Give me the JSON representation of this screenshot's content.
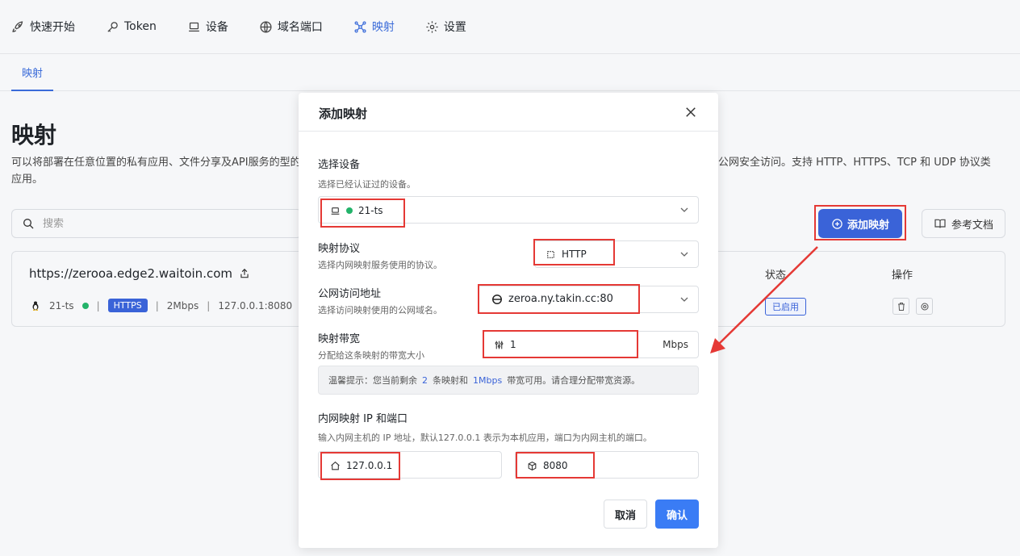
{
  "nav": {
    "items": [
      {
        "label": "快速开始",
        "icon": "rocket-icon"
      },
      {
        "label": "Token",
        "icon": "key-icon"
      },
      {
        "label": "设备",
        "icon": "laptop-icon"
      },
      {
        "label": "域名端口",
        "icon": "globe-icon"
      },
      {
        "label": "映射",
        "icon": "network-icon",
        "active": true
      },
      {
        "label": "设置",
        "icon": "gear-icon"
      }
    ],
    "subtab": "映射"
  },
  "page": {
    "title": "映射",
    "desc_left": "可以将部署在任意位置的私有应用、文件分享及API服务的型的应用。",
    "desc_right": "公网安全访问。支持 HTTP、HTTPS、TCP 和 UDP 协议类",
    "search_placeholder": "搜索",
    "add_button": "添加映射",
    "docs_button": "参考文档"
  },
  "mapping": {
    "url": "https://zerooa.edge2.waitoin.com",
    "device": "21-ts",
    "protocol": "HTTPS",
    "bandwidth": "2Mbps",
    "target": "127.0.0.1:8080",
    "status_header": "状态",
    "ops_header": "操作",
    "status": "已启用"
  },
  "modal": {
    "title": "添加映射",
    "device": {
      "label": "选择设备",
      "hint": "选择已经认证过的设备。",
      "value": "21-ts"
    },
    "protocol": {
      "label": "映射协议",
      "hint": "选择内网映射服务使用的协议。",
      "value": "HTTP"
    },
    "domain": {
      "label": "公网访问地址",
      "hint": "选择访问映射使用的公网域名。",
      "value": "zeroa.ny.takin.cc:80"
    },
    "bandwidth": {
      "label": "映射带宽",
      "hint": "分配给这条映射的带宽大小",
      "value": "1",
      "unit": "Mbps"
    },
    "tip": {
      "prefix": "温馨提示：您当前剩余",
      "count": "2",
      "mid": "条映射和",
      "bw": "1Mbps",
      "suffix": "带宽可用。请合理分配带宽资源。"
    },
    "target": {
      "label": "内网映射 IP 和端口",
      "hint": "输入内网主机的 IP 地址，默认127.0.0.1 表示为本机应用，端口为内网主机的端口。",
      "ip": "127.0.0.1",
      "port": "8080"
    },
    "cancel": "取消",
    "confirm": "确认"
  },
  "colors": {
    "accent": "#3a63d8",
    "annotation": "#e53935",
    "online": "#23b36a"
  }
}
